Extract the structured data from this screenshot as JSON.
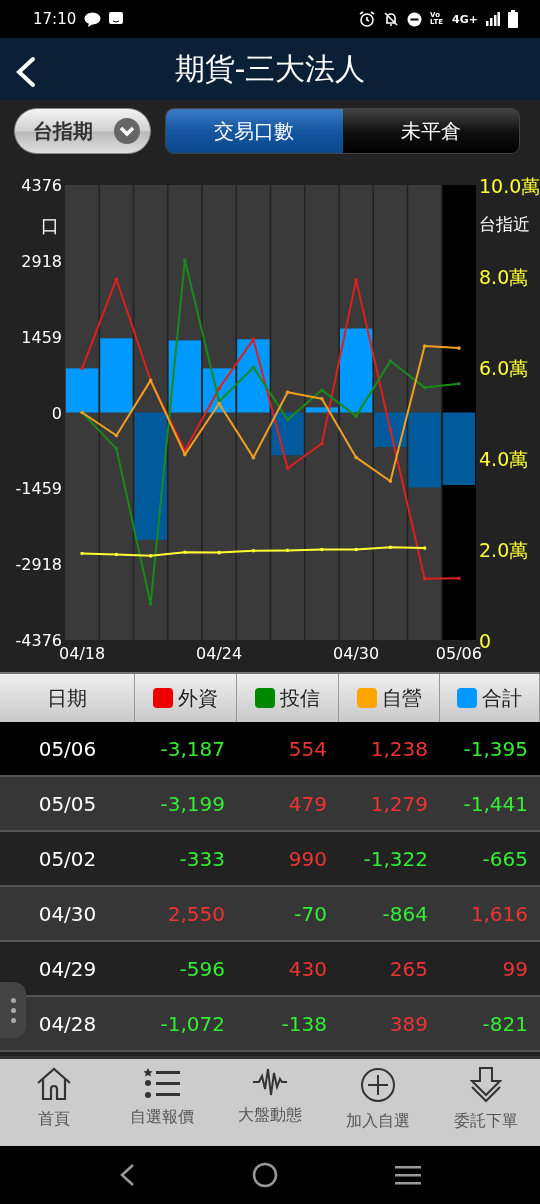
{
  "status_bar": {
    "time": "17:10",
    "volte": "VoLTE",
    "network": "4G+"
  },
  "header": {
    "title": "期貨-三大法人"
  },
  "product_select": {
    "value": "台指期"
  },
  "tabs": [
    {
      "label": "交易口數",
      "selected": true
    },
    {
      "label": "未平倉",
      "selected": false
    }
  ],
  "chart": {
    "chart_data": {
      "type": "bar",
      "ylabel": "口",
      "categories": [
        "04/18",
        null,
        null,
        null,
        "04/24",
        null,
        null,
        null,
        "04/30",
        null,
        null,
        "05/06"
      ],
      "ylim": [
        -4376,
        4376
      ],
      "yticks": [
        4376,
        2918,
        1459,
        0,
        -1459,
        -2918,
        -4376
      ],
      "y2lim": [
        0,
        10
      ],
      "y2ticks": [
        {
          "value": 10,
          "label": "10.0萬"
        },
        {
          "value": 8,
          "label": "8.0萬"
        },
        {
          "value": 6,
          "label": "6.0萬"
        },
        {
          "value": 4,
          "label": "4.0萬"
        },
        {
          "value": 2,
          "label": "2.0萬"
        },
        {
          "value": 0,
          "label": "0"
        }
      ],
      "series": [
        {
          "color": "#0099ff",
          "values": [
            848,
            1427,
            null,
            1387,
            849,
            1407,
            null,
            99,
            1616,
            null,
            null,
            null
          ]
        },
        {
          "color": "#005a9c",
          "values": [
            null,
            null,
            -2448,
            null,
            null,
            null,
            -821,
            null,
            null,
            -665,
            -1441,
            -1395
          ]
        },
        {
          "type": "line",
          "color": "#dd2020",
          "values": [
            848,
            2564,
            617,
            -733,
            463,
            1407,
            -1072,
            -596,
            2550,
            -333,
            -3199,
            -3187
          ]
        },
        {
          "type": "line",
          "color": "#1a8a1a",
          "values": [
            0,
            -694,
            -3682,
            2930,
            212,
            868,
            -138,
            430,
            -70,
            990,
            479,
            554
          ]
        },
        {
          "type": "line",
          "color": "#f0a020",
          "values": [
            0,
            -443,
            617,
            -810,
            174,
            -868,
            389,
            265,
            -864,
            -1322,
            1279,
            1238
          ]
        },
        {
          "name": "台指近",
          "type": "line",
          "axis": "y2",
          "color": "#ffff33",
          "values": [
            1.9,
            1.88,
            1.85,
            1.93,
            1.92,
            1.96,
            1.97,
            1.99,
            1.99,
            2.04,
            2.02,
            null
          ]
        }
      ]
    }
  },
  "table": {
    "columns": [
      {
        "label": "日期"
      },
      {
        "label": "外資",
        "color": "#ee0000"
      },
      {
        "label": "投信",
        "color": "#008800"
      },
      {
        "label": "自營",
        "color": "#ffa500"
      },
      {
        "label": "合計",
        "color": "#0099ff"
      }
    ],
    "rows": [
      {
        "selected": true,
        "cells": [
          {
            "value": "05/06"
          },
          {
            "value": "-3,187",
            "color": "#33ee33"
          },
          {
            "value": "554",
            "color": "#ee3333"
          },
          {
            "value": "1,238",
            "color": "#ee3333"
          },
          {
            "value": "-1,395",
            "color": "#33ee33"
          }
        ]
      },
      {
        "selected": false,
        "cells": [
          {
            "value": "05/05"
          },
          {
            "value": "-3,199",
            "color": "#33ee33"
          },
          {
            "value": "479",
            "color": "#ee3333"
          },
          {
            "value": "1,279",
            "color": "#ee3333"
          },
          {
            "value": "-1,441",
            "color": "#33ee33"
          }
        ]
      },
      {
        "selected": false,
        "cells": [
          {
            "value": "05/02"
          },
          {
            "value": "-333",
            "color": "#33ee33"
          },
          {
            "value": "990",
            "color": "#ee3333"
          },
          {
            "value": "-1,322",
            "color": "#33ee33"
          },
          {
            "value": "-665",
            "color": "#33ee33"
          }
        ]
      },
      {
        "selected": false,
        "cells": [
          {
            "value": "04/30"
          },
          {
            "value": "2,550",
            "color": "#ee3333"
          },
          {
            "value": "-70",
            "color": "#33ee33"
          },
          {
            "value": "-864",
            "color": "#33ee33"
          },
          {
            "value": "1,616",
            "color": "#ee3333"
          }
        ]
      },
      {
        "selected": false,
        "cells": [
          {
            "value": "04/29"
          },
          {
            "value": "-596",
            "color": "#33ee33"
          },
          {
            "value": "430",
            "color": "#ee3333"
          },
          {
            "value": "265",
            "color": "#ee3333"
          },
          {
            "value": "99",
            "color": "#ee3333"
          }
        ]
      },
      {
        "selected": false,
        "cells": [
          {
            "value": "04/28"
          },
          {
            "value": "-1,072",
            "color": "#33ee33"
          },
          {
            "value": "-138",
            "color": "#33ee33"
          },
          {
            "value": "389",
            "color": "#ee3333"
          },
          {
            "value": "-821",
            "color": "#33ee33"
          }
        ]
      }
    ]
  },
  "bottom_nav": [
    {
      "label": "首頁",
      "kind": "home"
    },
    {
      "label": "自選報價",
      "kind": "watchlist"
    },
    {
      "label": "大盤動態",
      "kind": "market"
    },
    {
      "label": "加入自選",
      "kind": "add"
    },
    {
      "label": "委託下單",
      "kind": "order"
    }
  ]
}
